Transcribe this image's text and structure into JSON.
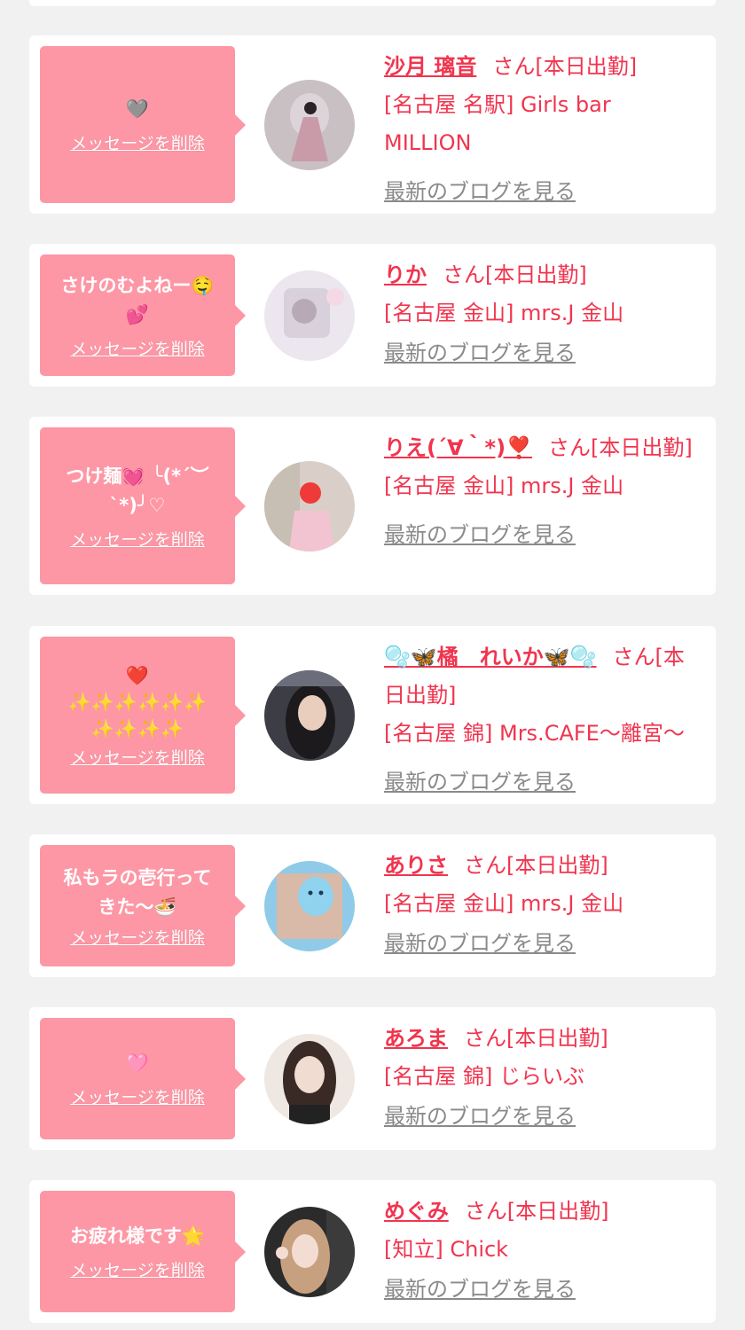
{
  "theme": {
    "page_bg": "#f1f1f1",
    "card_bg": "#ffffff",
    "bubble_bg": "#fd97a5",
    "accent": "#f0354f",
    "muted": "#8a8a8a"
  },
  "entries": [
    {
      "message": "🩶",
      "delete_label": "メッセージを削除",
      "name": "沙月 璃音",
      "suffix": "さん[本日出勤]",
      "shop": "[名古屋 名駅] Girls bar MILLION",
      "blog_label": "最新のブログを見る",
      "avatar_color": "#c9c0c4"
    },
    {
      "message": "さけのむよねー🤤\n💕",
      "delete_label": "メッセージを削除",
      "name": "りか",
      "suffix": "さん[本日出勤]",
      "shop": "[名古屋 金山] mrs.J 金山",
      "blog_label": "最新のブログを見る",
      "avatar_color": "#ece6ee"
    },
    {
      "message": "つけ麺💓 ╰(*´︶`*)╯♡",
      "delete_label": "メッセージを削除",
      "name": "りえ(´∀｀*)❣️",
      "suffix": "さん[本日出勤]",
      "shop": "[名古屋 金山] mrs.J 金山",
      "blog_label": "最新のブログを見る",
      "avatar_color": "#d9cfc8"
    },
    {
      "message": "❤️\n✨✨✨✨✨✨\n✨✨✨✨",
      "delete_label": "メッセージを削除",
      "name": "🫧🦋橘　れいか🦋🫧",
      "suffix": "さん[本日出勤]",
      "shop": "[名古屋 錦] Mrs.CAFE〜離宮〜",
      "blog_label": "最新のブログを見る",
      "avatar_color": "#3d3d45"
    },
    {
      "message": "私もラの壱行って\nきた〜🍜",
      "delete_label": "メッセージを削除",
      "name": "ありさ",
      "suffix": "さん[本日出勤]",
      "shop": "[名古屋 金山] mrs.J 金山",
      "blog_label": "最新のブログを見る",
      "avatar_color": "#8fcbe8"
    },
    {
      "message": "🩷",
      "delete_label": "メッセージを削除",
      "name": "あろま",
      "suffix": "さん[本日出勤]",
      "shop": "[名古屋 錦] じらいぶ",
      "blog_label": "最新のブログを見る",
      "avatar_color": "#efe7e2"
    },
    {
      "message": "お疲れ様です🌟",
      "delete_label": "メッセージを削除",
      "name": "めぐみ",
      "suffix": "さん[本日出勤]",
      "shop": "[知立] Chick",
      "blog_label": "最新のブログを見る",
      "avatar_color": "#2b2b2b"
    }
  ]
}
